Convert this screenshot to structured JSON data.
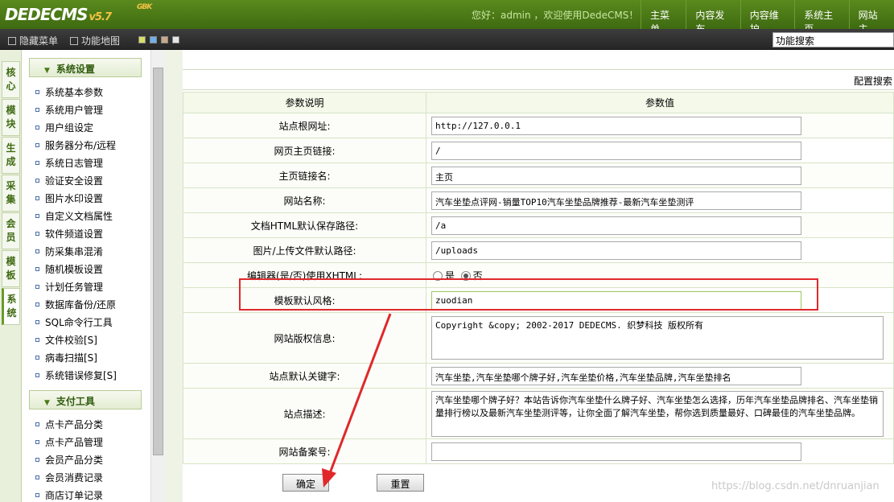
{
  "top": {
    "logo": "DEDECMS",
    "version": "v5.7",
    "version_tag": "GBK",
    "welcome": "您好：admin ，欢迎使用DedeCMS！",
    "nav": [
      "主菜单",
      "内容发布",
      "内容维护",
      "系统主页",
      "网站主"
    ]
  },
  "toolbar": {
    "hide_menu": "隐藏菜单",
    "func_map": "功能地图",
    "swatches": [
      "#d4e066",
      "#6fb0e8",
      "#c9a98a",
      "#e6e6e6"
    ],
    "search_value": "功能搜索"
  },
  "vtabs": [
    "核心",
    "模块",
    "生成",
    "采集",
    "会员",
    "模板",
    "系统"
  ],
  "sidebar": {
    "group1": {
      "title": "系统设置",
      "items": [
        "系统基本参数",
        "系统用户管理",
        "用户组设定",
        "服务器分布/远程",
        "系统日志管理",
        "验证安全设置",
        "图片水印设置",
        "自定义文档属性",
        "软件频道设置",
        "防采集串混淆",
        "随机模板设置",
        "计划任务管理",
        "数据库备份/还原",
        "SQL命令行工具",
        "文件校验[S]",
        "病毒扫描[S]",
        "系统错误修复[S]"
      ]
    },
    "group2": {
      "title": "支付工具",
      "items": [
        "点卡产品分类",
        "点卡产品管理",
        "会员产品分类",
        "会员消费记录",
        "商店订单记录"
      ]
    }
  },
  "main": {
    "config_search": "配置搜索",
    "header_label": "参数说明",
    "header_value": "参数值",
    "rows": [
      {
        "label": "站点根网址:",
        "value": "http://127.0.0.1"
      },
      {
        "label": "网页主页链接:",
        "value": "/"
      },
      {
        "label": "主页链接名:",
        "value": "主页"
      },
      {
        "label": "网站名称:",
        "value": "汽车坐垫点评网-销量TOP10汽车坐垫品牌推荐-最新汽车坐垫测评"
      },
      {
        "label": "文档HTML默认保存路径:",
        "value": "/a"
      },
      {
        "label": "图片/上传文件默认路径:",
        "value": "/uploads"
      }
    ],
    "xhtml": {
      "label": "编辑器(是/否)使用XHTML:",
      "yes": "是",
      "no": "否",
      "selected": "否"
    },
    "template": {
      "label": "模板默认风格:",
      "value": "zuodian"
    },
    "copyright": {
      "label": "网站版权信息:",
      "value": "Copyright &copy; 2002-2017 DEDECMS. 织梦科技 版权所有"
    },
    "keywords": {
      "label": "站点默认关键字:",
      "value": "汽车坐垫,汽车坐垫哪个牌子好,汽车坐垫价格,汽车坐垫品牌,汽车坐垫排名"
    },
    "description": {
      "label": "站点描述:",
      "value": "汽车坐垫哪个牌子好？本站告诉你汽车坐垫什么牌子好、汽车坐垫怎么选择，历年汽车坐垫品牌排名、汽车坐垫销量排行榜以及最新汽车坐垫测评等，让你全面了解汽车坐垫，帮你选到质量最好、口碑最佳的汽车坐垫品牌。"
    },
    "beian": {
      "label": "网站备案号:",
      "value": ""
    },
    "ok": "确定",
    "reset": "重置"
  },
  "watermark": "https://blog.csdn.net/dnruanjian"
}
